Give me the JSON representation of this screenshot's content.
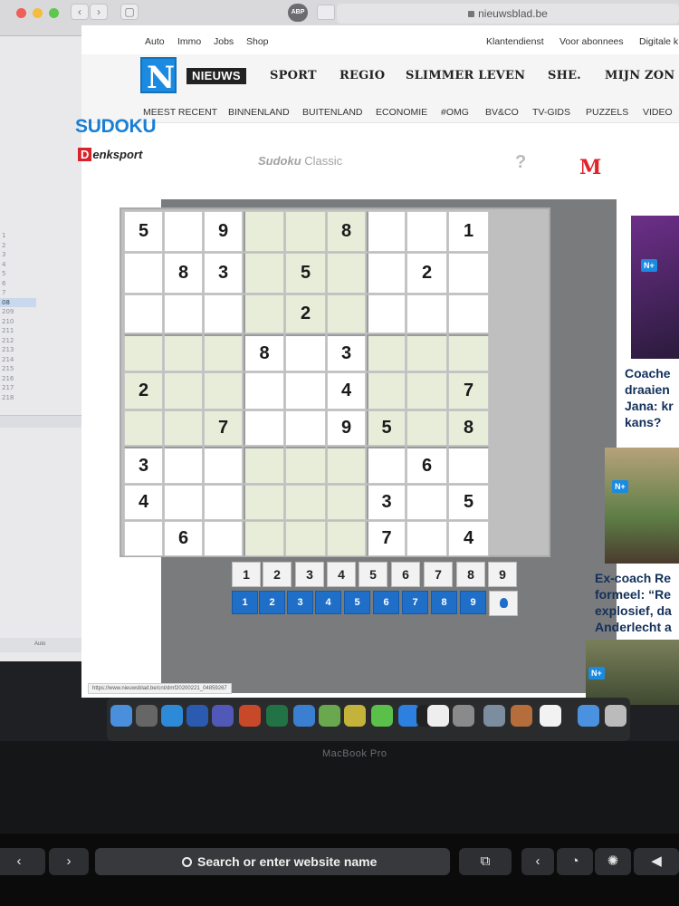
{
  "browser": {
    "url": "nieuwsblad.be",
    "ext_label": "ABP",
    "back_icon": "chevron-left-icon",
    "forward_icon": "chevron-right-icon"
  },
  "topnav": {
    "left": [
      "Auto",
      "Immo",
      "Jobs",
      "Shop"
    ],
    "right": [
      "Klantendienst",
      "Voor abonnees",
      "Digitale k"
    ]
  },
  "mainnav": {
    "logo": "N",
    "items": [
      "NIEUWS",
      "SPORT",
      "REGIO",
      "SLIMMER LEVEN",
      "SHE.",
      "MIJN ZON"
    ]
  },
  "subnav": [
    "MEEST RECENT",
    "BINNENLAND",
    "BUITENLAND",
    "ECONOMIE",
    "#OMG",
    "BV&CO",
    "TV-GIDS",
    "PUZZELS",
    "VIDEO"
  ],
  "page_title": "SUDOKU",
  "game": {
    "brand_initial": "D",
    "brand_rest": "enksport",
    "mode_bold": "Sudoku",
    "mode_rest": " Classic",
    "help": "?",
    "grid": [
      [
        "5",
        "",
        "9",
        "",
        "",
        "8",
        "",
        "",
        "1"
      ],
      [
        "",
        "8",
        "3",
        "",
        "5",
        "",
        "",
        "2",
        ""
      ],
      [
        "",
        "",
        "",
        "",
        "2",
        "",
        "",
        "",
        ""
      ],
      [
        "",
        "",
        "",
        "8",
        "",
        "3",
        "",
        "",
        ""
      ],
      [
        "2",
        "",
        "",
        "",
        "",
        "4",
        "",
        "",
        "7"
      ],
      [
        "",
        "",
        "7",
        "",
        "",
        "9",
        "5",
        "",
        "8"
      ],
      [
        "3",
        "",
        "",
        "",
        "",
        "",
        "",
        "6",
        ""
      ],
      [
        "4",
        "",
        "",
        "",
        "",
        "",
        "3",
        "",
        "5"
      ],
      [
        "",
        "6",
        "",
        "",
        "",
        "",
        "7",
        "",
        "4"
      ]
    ],
    "numpad": [
      "1",
      "2",
      "3",
      "4",
      "5",
      "6",
      "7",
      "8",
      "9"
    ],
    "pencil": [
      "1",
      "2",
      "3",
      "4",
      "5",
      "6",
      "7",
      "8",
      "9"
    ],
    "hint_icon": "lightbulb-icon"
  },
  "sidebar": {
    "initial": "M",
    "badge": "N+",
    "articles": [
      "Coache draaien Jana: kr kans?",
      "Ex-coach Re formeel: “Re explosief, da Anderlecht a"
    ]
  },
  "status_url": "https://www.nieuwsblad.be/cnt/dmf20200221_04859267",
  "laptop_label": "MacBook Pro",
  "touchbar": {
    "search_text": "Search or enter website name",
    "back": "‹",
    "forward": "›"
  },
  "ghost": {
    "lines": [
      "1",
      "2",
      "3",
      "4",
      "5",
      "6",
      "7",
      "08",
      "209",
      "210",
      "211",
      "212",
      "213",
      "214",
      "215",
      "216",
      "217",
      "218"
    ],
    "bottom": "Auto"
  }
}
